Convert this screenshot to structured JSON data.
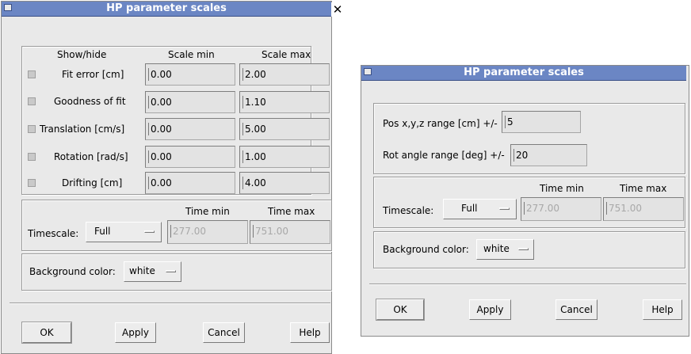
{
  "dialog1": {
    "title": "HP parameter scales",
    "headers": {
      "show_hide": "Show/hide",
      "scale_min": "Scale min",
      "scale_max": "Scale max"
    },
    "rows": [
      {
        "label": "Fit error [cm]",
        "min": "0.00",
        "max": "2.00"
      },
      {
        "label": "Goodness of fit",
        "min": "0.00",
        "max": "1.10"
      },
      {
        "label": "Translation [cm/s]",
        "min": "0.00",
        "max": "5.00"
      },
      {
        "label": "Rotation [rad/s]",
        "min": "0.00",
        "max": "1.00"
      },
      {
        "label": "Drifting [cm]",
        "min": "0.00",
        "max": "4.00"
      }
    ],
    "timescale": {
      "label": "Timescale:",
      "value": "Full",
      "time_min_label": "Time min",
      "time_max_label": "Time max",
      "time_min": "277.00",
      "time_max": "751.00"
    },
    "background": {
      "label": "Background color:",
      "value": "white"
    },
    "buttons": {
      "ok": "OK",
      "apply": "Apply",
      "cancel": "Cancel",
      "help": "Help"
    }
  },
  "dialog2": {
    "title": "HP parameter scales",
    "pos_range": {
      "label": "Pos x,y,z range [cm] +/-",
      "value": "5"
    },
    "rot_range": {
      "label": "Rot angle range [deg] +/-",
      "value": "20"
    },
    "timescale": {
      "label": "Timescale:",
      "value": "Full",
      "time_min_label": "Time min",
      "time_max_label": "Time max",
      "time_min": "277.00",
      "time_max": "751.00"
    },
    "background": {
      "label": "Background color:",
      "value": "white"
    },
    "buttons": {
      "ok": "OK",
      "apply": "Apply",
      "cancel": "Cancel",
      "help": "Help"
    }
  }
}
